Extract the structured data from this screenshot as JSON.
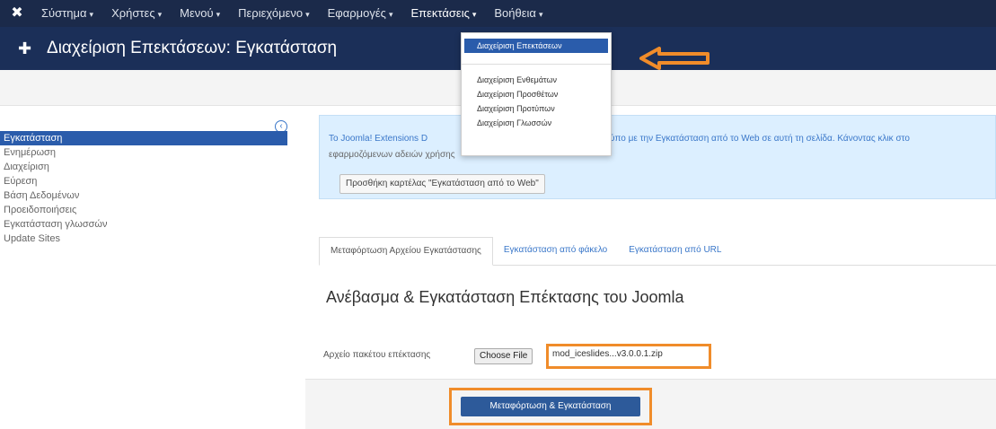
{
  "topnav": {
    "logo_icon": "joomla-logo-icon",
    "menu": [
      {
        "label": "Σύστημα",
        "caret": "▾"
      },
      {
        "label": "Χρήστες",
        "caret": "▾"
      },
      {
        "label": "Μενού",
        "caret": "▾"
      },
      {
        "label": "Περιεχόμενο",
        "caret": "▾"
      },
      {
        "label": "Εφαρμογές",
        "caret": "▾"
      },
      {
        "label": "Επεκτάσεις",
        "caret": "▾"
      },
      {
        "label": "Βοήθεια",
        "caret": "▾"
      }
    ]
  },
  "header": {
    "icon": "puzzle-icon",
    "title": "Διαχείριση Επεκτάσεων: Εγκατάσταση"
  },
  "dropdown": {
    "items": [
      "Διαχείριση Επεκτάσεων",
      "Διαχείριση Ενθεμάτων",
      "Διαχείριση Προσθέτων",
      "Διαχείριση Προτύπων",
      "Διαχείριση Γλωσσών"
    ]
  },
  "sidebar": {
    "collapse_icon": "collapse-circle-icon",
    "items": [
      "Εγκατάσταση",
      "Ενημέρωση",
      "Διαχείριση",
      "Εύρεση",
      "Βάση Δεδομένων",
      "Προειδοποιήσεις",
      "Εγκατάσταση γλωσσών",
      "Update Sites"
    ]
  },
  "info": {
    "line1_start": "Το Joomla! Extensions D",
    "line1_end": "ύπο με την Εγκατάσταση από το Web σε αυτή τη σελίδα. Κάνοντας κλικ στο",
    "line2": "εφαρμοζόμενων αδειών χρήσης",
    "button": "Προσθήκη καρτέλας \"Εγκατάσταση από το Web\""
  },
  "tabs": [
    "Μεταφόρτωση Αρχείου Εγκατάστασης",
    "Εγκατάσταση από φάκελο",
    "Εγκατάσταση από URL"
  ],
  "main": {
    "heading": "Ανέβασμα & Εγκατάσταση Επέκτασης του Joomla",
    "file_label": "Αρχείο πακέτου επέκτασης",
    "choose_button": "Choose File",
    "file_name": "mod_iceslides...v3.0.0.1.zip",
    "upload_button": "Μεταφόρτωση & Εγκατάσταση"
  },
  "colors": {
    "topnav": "#1b2a4a",
    "header": "#1b2f58",
    "accent": "#2a5cab",
    "highlight": "#f08c2a"
  }
}
